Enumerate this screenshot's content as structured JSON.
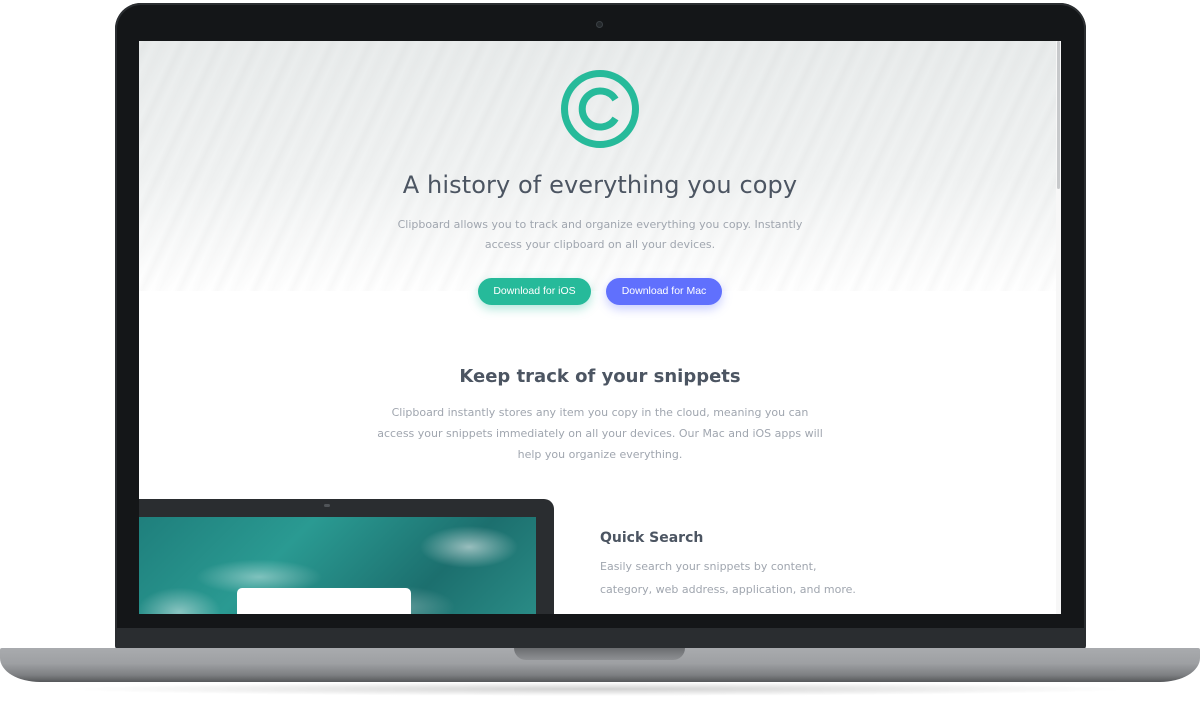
{
  "hero": {
    "logo_icon": "copyright-circle-icon",
    "title": "A history of everything you copy",
    "description": "Clipboard allows you to track and organize everything you copy. Instantly access your clipboard on all your devices.",
    "buttons": {
      "ios_label": "Download for iOS",
      "mac_label": "Download for Mac"
    }
  },
  "snippets": {
    "title": "Keep track of your snippets",
    "description": "Clipboard instantly stores any item you copy in the cloud, meaning you can access your snippets immediately on all your devices. Our Mac and iOS apps will help you organize everything."
  },
  "features": [
    {
      "title": "Quick Search",
      "description": "Easily search your snippets by content, category, web address, application, and more."
    }
  ],
  "colors": {
    "accent_green": "#26ba9a",
    "accent_blue": "#6070fd",
    "heading": "#4c5562",
    "body_text": "#a0a6af"
  }
}
